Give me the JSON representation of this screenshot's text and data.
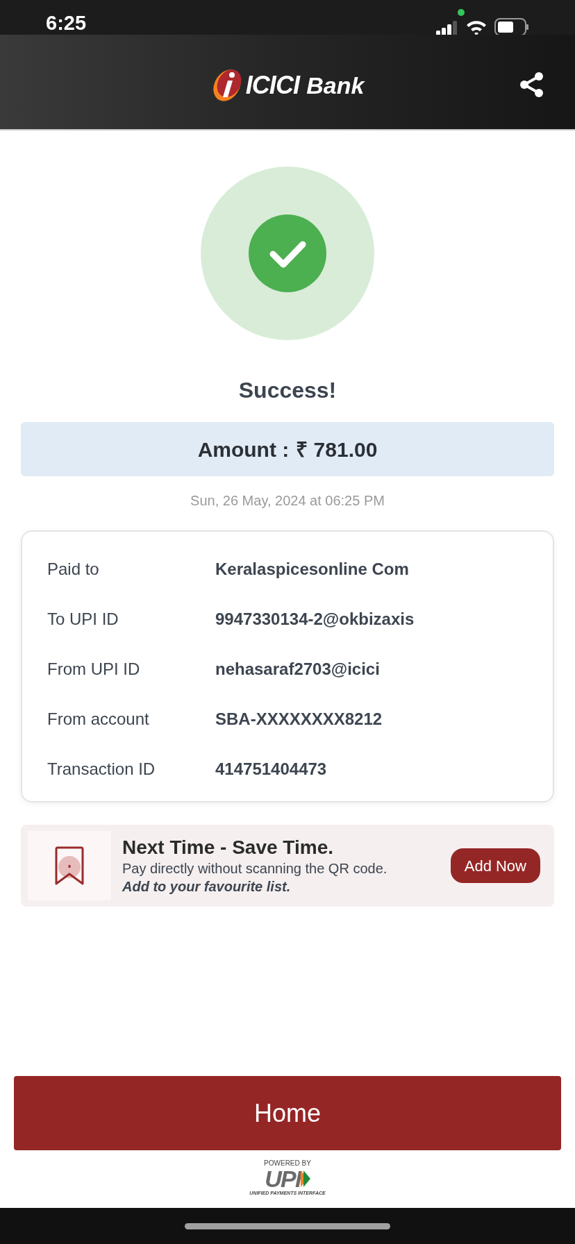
{
  "status_bar": {
    "time": "6:25"
  },
  "header": {
    "logo_word": "ICICI",
    "logo_suffix": "Bank"
  },
  "result": {
    "title": "Success!",
    "amount_label": "Amount :",
    "amount": "₹ 781.00",
    "datetime": "Sun, 26 May, 2024 at 06:25 PM"
  },
  "details": [
    {
      "label": "Paid to",
      "value": "Keralaspicesonline Com"
    },
    {
      "label": "To UPI ID",
      "value": "9947330134-2@okbizaxis"
    },
    {
      "label": "From UPI ID",
      "value": "nehasaraf2703@icici"
    },
    {
      "label": "From account",
      "value": "SBA-XXXXXXXX8212"
    },
    {
      "label": "Transaction ID",
      "value": "414751404473"
    }
  ],
  "promo": {
    "title": "Next Time - Save Time.",
    "text": "Pay directly without scanning the QR code.",
    "note": "Add to your favourite list.",
    "button": "Add Now"
  },
  "home_button": "Home",
  "footer": {
    "powered_by": "POWERED BY",
    "logo": "UPI",
    "tagline": "UNIFIED PAYMENTS INTERFACE"
  }
}
